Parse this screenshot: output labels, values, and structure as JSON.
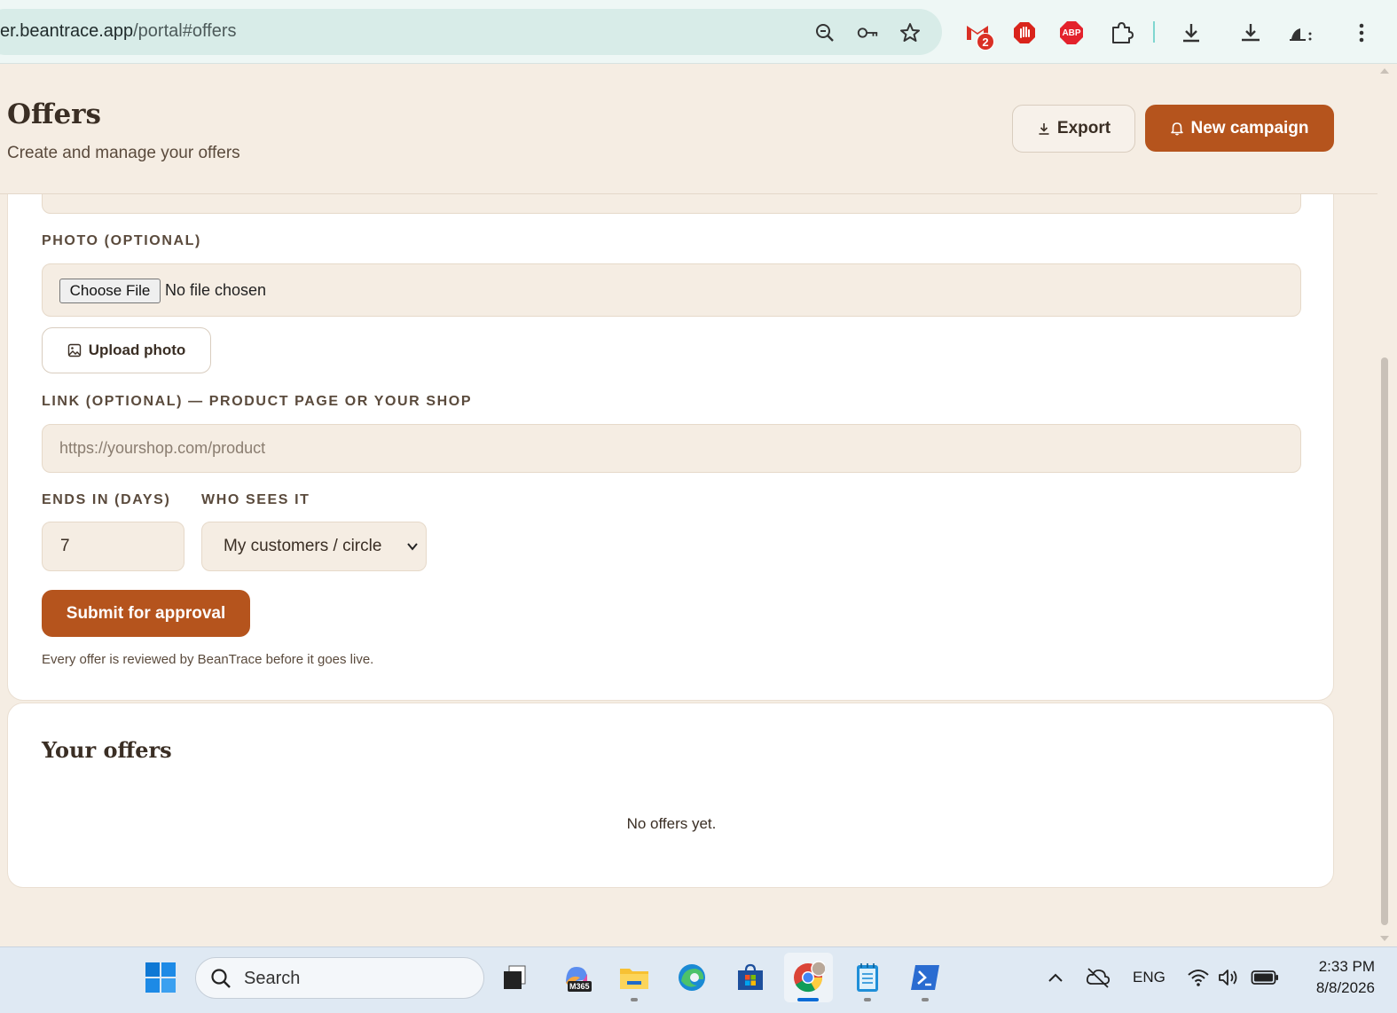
{
  "browser": {
    "url_host": "er.beantrace.app",
    "url_path": "/portal#offers",
    "gmail_badge": "2",
    "abp_label": "ABP"
  },
  "header": {
    "title": "Offers",
    "subtitle": "Create and manage your offers",
    "export_label": "Export",
    "new_campaign_label": "New campaign"
  },
  "form": {
    "photo_label": "PHOTO (OPTIONAL)",
    "choose_file_label": "Choose File",
    "no_file_text": "No file chosen",
    "upload_photo_label": "Upload photo",
    "link_label": "LINK (OPTIONAL) — PRODUCT PAGE OR YOUR SHOP",
    "link_placeholder": "https://yourshop.com/product",
    "ends_label": "ENDS IN (DAYS)",
    "ends_value": "7",
    "who_label": "WHO SEES IT",
    "who_value": "My customers / circle",
    "submit_label": "Submit for approval",
    "review_note": "Every offer is reviewed by BeanTrace before it goes live."
  },
  "offers": {
    "title": "Your offers",
    "empty_text": "No offers yet."
  },
  "taskbar": {
    "search_placeholder": "Search",
    "m365_label": "M365",
    "language": "ENG",
    "time": "2:33 PM",
    "date": "8/8/2026"
  },
  "colors": {
    "accent": "#b5541d",
    "page_bg": "#f5ede3",
    "card_bg": "#ffffff"
  }
}
